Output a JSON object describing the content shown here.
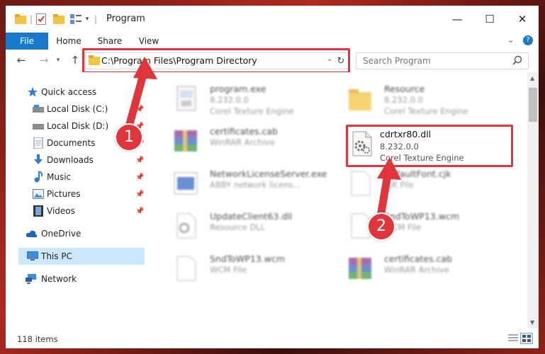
{
  "window": {
    "title": "Program"
  },
  "ribbon": {
    "tabs": [
      "File",
      "Home",
      "Share",
      "View"
    ]
  },
  "address": {
    "path": "C:\\Program Files\\Program Directory"
  },
  "search": {
    "placeholder": "Search Program"
  },
  "sidebar": {
    "items": [
      {
        "label": "Quick access",
        "icon": "star-icon"
      },
      {
        "label": "Local Disk (C:)",
        "icon": "drive-icon"
      },
      {
        "label": "Local Disk (D:)",
        "icon": "drive-icon"
      },
      {
        "label": "Documents",
        "icon": "documents-icon"
      },
      {
        "label": "Downloads",
        "icon": "download-icon"
      },
      {
        "label": "Music",
        "icon": "music-icon"
      },
      {
        "label": "Pictures",
        "icon": "pictures-icon"
      },
      {
        "label": "Videos",
        "icon": "videos-icon"
      },
      {
        "label": "OneDrive",
        "icon": "cloud-icon"
      },
      {
        "label": "This PC",
        "icon": "computer-icon"
      },
      {
        "label": "Network",
        "icon": "network-icon"
      }
    ]
  },
  "files": [
    {
      "name": "program.exe",
      "line1": "8.232.0.0",
      "line2": "Corel Texture Engine"
    },
    {
      "name": "Resource",
      "line1": "8.232.0.0",
      "line2": "Corel Texture Engine"
    },
    {
      "name": "certificates.cab",
      "line1": "WinRAR Archive",
      "line2": ""
    },
    {
      "name": "cdrtxr80.dll",
      "line1": "8.232.0.0",
      "line2": "Corel Texture Engine"
    },
    {
      "name": "NetworkLicenseServer.exe",
      "line1": "ABBY network licens...",
      "line2": ""
    },
    {
      "name": "DefaultFont.cjk",
      "line1": "CJK File",
      "line2": ""
    },
    {
      "name": "UpdateClient63.dll",
      "line1": "Resource DLL",
      "line2": ""
    },
    {
      "name": "SndToWP13.wcm",
      "line1": "WCM File",
      "line2": ""
    },
    {
      "name": "SndToWP13.wcm",
      "line1": "WCM File",
      "line2": ""
    },
    {
      "name": "certificates.cab",
      "line1": "WinRAR Archive",
      "line2": ""
    }
  ],
  "status": {
    "count": "118 items"
  },
  "callouts": {
    "one": "1",
    "two": "2"
  },
  "colors": {
    "accent": "#1979ca",
    "highlight": "#e0353b",
    "selected": "#cce8ff"
  }
}
